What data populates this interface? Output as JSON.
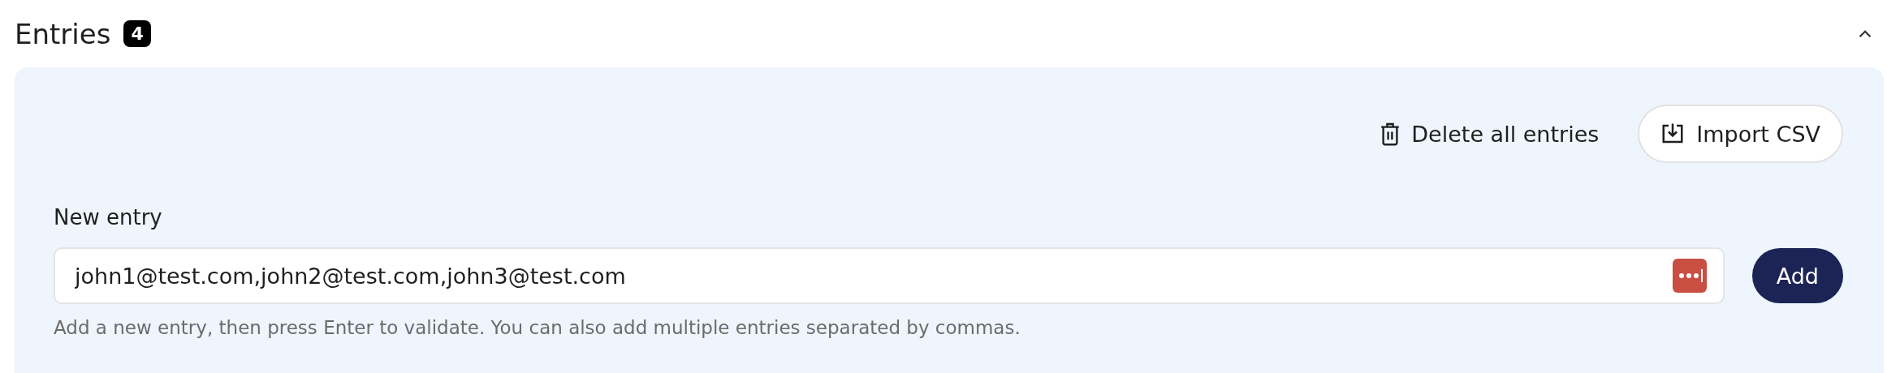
{
  "section": {
    "title": "Entries",
    "count": "4",
    "expanded": true
  },
  "actions": [
    {
      "kind": "link",
      "label": "Delete all entries"
    },
    {
      "kind": "button",
      "label": "Import CSV"
    }
  ],
  "new_entry": {
    "label": "New entry",
    "value": "john1@test.com,john2@test.com,john3@test.com",
    "button": "Add",
    "help": "Add a new entry, then press Enter to validate. You can also add multiple entries separated by commas."
  }
}
